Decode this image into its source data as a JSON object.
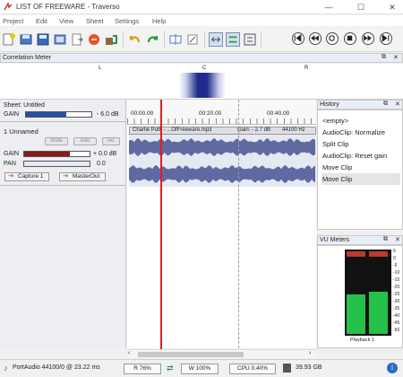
{
  "window": {
    "title": "LIST OF FREEWARE - Traverso",
    "min_glyph": "—",
    "max_glyph": "☐",
    "close_glyph": "✕"
  },
  "menu": [
    "Project",
    "Edit",
    "View",
    "Sheet",
    "Settings",
    "Help"
  ],
  "toolbar_icons": [
    "new-project-icon",
    "save-icon",
    "save-all-icon",
    "new-sheet-icon",
    "export-icon",
    "record-icon",
    "import-icon",
    "undo-icon",
    "redo-icon",
    "snap-icon",
    "edit-icon",
    "follow-icon",
    "zoom-fit-icon",
    "track-icon"
  ],
  "transport": [
    "skip-start",
    "rewind",
    "stop",
    "play",
    "forward",
    "skip-end"
  ],
  "correlation": {
    "title": "Correlation Meter",
    "left_label": "L",
    "center_label": "C",
    "right_label": "R"
  },
  "sheet": {
    "name": "Sheet: Untitled",
    "gain_label": "GAIN",
    "gain_value": "- 6.0 dB",
    "gain_level": 0.62
  },
  "track": {
    "name": "1  Unnamed",
    "mute": "mute",
    "solo": "solo",
    "rec": "rec",
    "gain_label": "GAIN",
    "gain_value": "+ 0.0 dB",
    "gain_level": 0.7,
    "pan_label": "PAN",
    "pan_value": "0.0",
    "capture": "Capture 1",
    "master": "MasterOut"
  },
  "ruler_ticks": [
    "00:00.00",
    "00:20.00",
    "00:40.00"
  ],
  "clip": {
    "name": "Charlie Puth - ...OfFreeware.mp3",
    "gain": "Gain: - 2.7 dB",
    "rate": "44100 Hz"
  },
  "history": {
    "title": "History",
    "items": [
      "<empty>",
      "AudioClip: Normalize",
      "Split Clip",
      "AudioClip: Reset gain",
      "Move Clip",
      "Move Clip"
    ],
    "selected": 5
  },
  "vu": {
    "title": "VU Meters",
    "scale": [
      "6",
      "0",
      "-5",
      "-10",
      "-15",
      "-20",
      "-25",
      "-30",
      "-35",
      "-40",
      "-45",
      "-50"
    ],
    "label": "Playback 1"
  },
  "status": {
    "audio": "PortAudio   44100/0 @ 23.22 ms",
    "r_load": "R 76%",
    "w_load": "W 100%",
    "cpu": "CPU 0.40%",
    "disk": "39.93 GB"
  },
  "colors": {
    "accent": "#2a4fa8",
    "gain_red": "#8b1a1a",
    "playhead": "#e02020",
    "waveform": "#5f6aa3",
    "vu_green": "#24c24a"
  }
}
